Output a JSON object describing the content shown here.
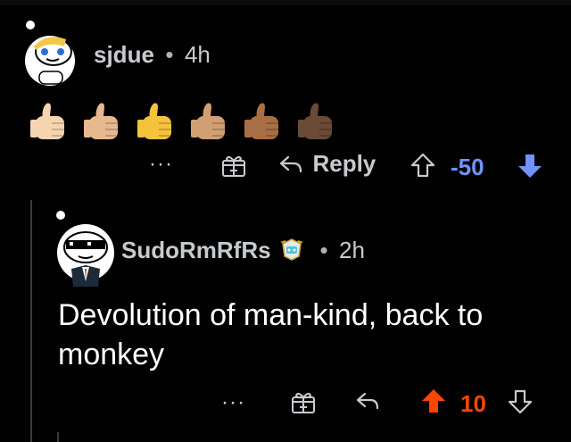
{
  "comment1": {
    "username": "sjdue",
    "separator": "•",
    "time": "4h",
    "emoji_colors": [
      "#f6d4b1",
      "#e8b98e",
      "#f5c33b",
      "#d29f73",
      "#a86f45",
      "#6b4a36"
    ],
    "actions": {
      "more": "···",
      "reply": "Reply",
      "vote_count": "-50",
      "vote_color": "#7193ff",
      "downvote_active": true
    }
  },
  "comment2": {
    "username": "SudoRmRfRs",
    "separator": "•",
    "time": "2h",
    "text": "Devolution of man-kind, back to monkey",
    "actions": {
      "more": "···",
      "vote_count": "10",
      "vote_color": "#ff4500",
      "upvote_active": true
    }
  }
}
